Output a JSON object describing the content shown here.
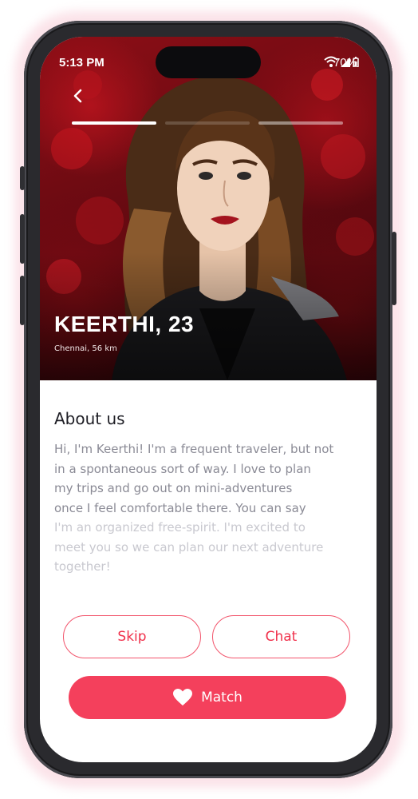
{
  "status_bar": {
    "time": "5:13 PM",
    "battery": "70%"
  },
  "profile": {
    "name": "KEERTHI, 23",
    "location": "Chennai, 56 km",
    "photo_progress": {
      "segments": 3,
      "active_index": 0
    }
  },
  "about": {
    "title": "About us",
    "lines": [
      "Hi, I'm Keerthi! I'm a frequent traveler, but not",
      "in a spontaneous sort of way. I love to plan",
      "my trips and go out on mini-adventures",
      "once I feel comfortable there. You can say",
      "I'm an organized free-spirit. I'm excited to",
      "meet you so we can plan our next adventure",
      "together!"
    ]
  },
  "actions": {
    "skip": "Skip",
    "chat": "Chat",
    "match": "Match"
  },
  "icons": {
    "back": "chevron-left-icon",
    "wifi": "wifi-icon",
    "signal": "signal-icon",
    "battery": "battery-icon",
    "match": "heart-icon"
  },
  "colors": {
    "accent": "#f4405c",
    "accent_text": "#f0304b",
    "outline": "#f2556c",
    "heading": "#1d1d24",
    "body_text": "#8a8a95",
    "body_text_faded": "#c8c8cf",
    "photo_background": "#8d0e16"
  }
}
